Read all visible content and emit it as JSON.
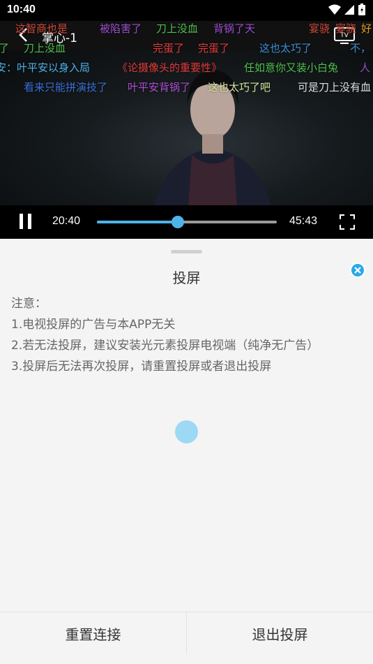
{
  "status_bar": {
    "time": "10:40",
    "icons": [
      "wifi-icon",
      "signal-icon",
      "battery-icon"
    ]
  },
  "player": {
    "title": "掌心-1",
    "current_time": "20:40",
    "total_time": "45:43",
    "progress": 0.45,
    "accent_color": "#4fb3ea",
    "danmaku": [
      {
        "text": "这智商也是",
        "color": "#d14a3a"
      },
      {
        "text": "被陷害了",
        "color": "#9b4fd1"
      },
      {
        "text": "刀上没血",
        "color": "#4fc04f"
      },
      {
        "text": "背锅了天",
        "color": "#9b4fd1"
      },
      {
        "text": "宴骁",
        "color": "#d14a3a"
      },
      {
        "text": "宴骁",
        "color": "#d14a3a"
      },
      {
        "text": "好",
        "color": "#e0a020"
      },
      {
        "text": "了",
        "color": "#4fc04f"
      },
      {
        "text": "刀上没血",
        "color": "#4fc04f"
      },
      {
        "text": "完蛋了",
        "color": "#e33b3b"
      },
      {
        "text": "完蛋了",
        "color": "#e33b3b"
      },
      {
        "text": "这也太巧了",
        "color": "#3b8fd6"
      },
      {
        "text": "不，",
        "color": "#3b8fd6"
      },
      {
        "text": "安：叶平安以身入局",
        "color": "#4fb3ea"
      },
      {
        "text": "《论摄像头的重要性》",
        "color": "#e33b3b"
      },
      {
        "text": "任如意你又装小白兔",
        "color": "#4fc04f"
      },
      {
        "text": "人",
        "color": "#9b4fd1"
      },
      {
        "text": "看来只能拼演技了",
        "color": "#3a6fd6"
      },
      {
        "text": "叶平安背锅了",
        "color": "#b04fd1"
      },
      {
        "text": "这也太巧了吧",
        "color": "#d8e8a0"
      },
      {
        "text": "可是刀上没有血",
        "color": "#e0e0e0"
      }
    ]
  },
  "cast_sheet": {
    "title": "投屏",
    "notes": [
      "注意：",
      "1.电视投屏的广告与本APP无关",
      "2.若无法投屏，建议安装光元素投屏电视端（纯净无广告）",
      "3.投屏后无法再次投屏，请重置投屏或者退出投屏"
    ],
    "reset_label": "重置连接",
    "exit_label": "退出投屏",
    "accent_color": "#2aa8e8"
  }
}
